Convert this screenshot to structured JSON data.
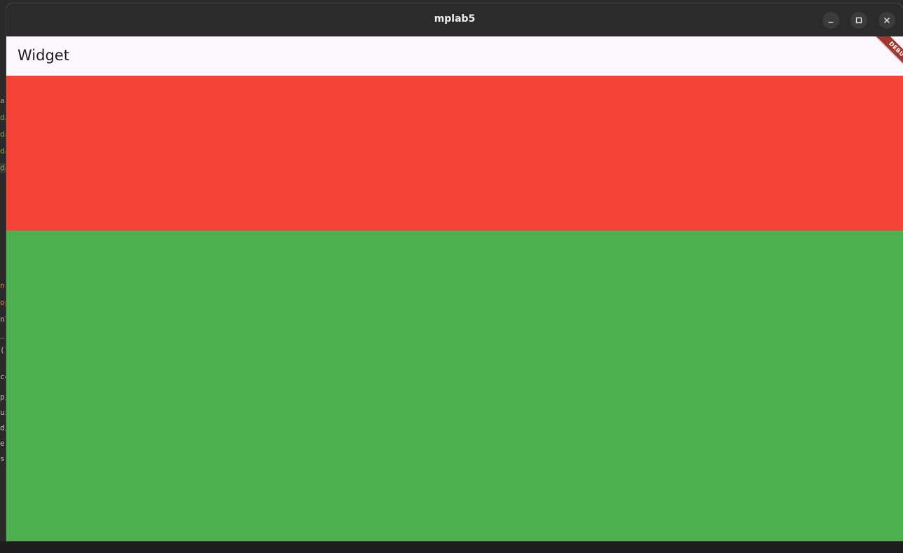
{
  "window": {
    "title": "mplab5",
    "controls": {
      "minimize_icon": "minimize-icon",
      "maximize_icon": "maximize-icon",
      "close_icon": "close-icon"
    }
  },
  "app": {
    "appbar_title": "Widget",
    "debug_banner": "DEBUG",
    "panels": [
      {
        "name": "red-container",
        "color": "#f44336"
      },
      {
        "name": "green-container",
        "color": "#4caf50"
      }
    ]
  },
  "background_editor": {
    "fragments": [
      {
        "text": "a",
        "color": "#9c9c9c"
      },
      {
        "text": "da",
        "color": "#7e9f5a"
      },
      {
        "text": "da",
        "color": "#7e9f5a"
      },
      {
        "text": "da",
        "color": "#7e9f5a"
      },
      {
        "text": "da",
        "color": "#7e9f5a"
      },
      {
        "text": "n",
        "color": "#d77c5a"
      },
      {
        "text": "op",
        "color": "#d77c5a"
      },
      {
        "text": "nl",
        "color": "#bdbdbd"
      },
      {
        "text": "_",
        "color": "#bdbdbd"
      },
      {
        "text": "(l",
        "color": "#bdbdbd"
      },
      {
        "text": "co",
        "color": "#bdbdbd"
      },
      {
        "text": "p/",
        "color": "#bdbdbd"
      },
      {
        "text": "ux",
        "color": "#bdbdbd"
      },
      {
        "text": "d/",
        "color": "#bdbdbd"
      },
      {
        "text": "e",
        "color": "#bdbdbd"
      },
      {
        "text": "s",
        "color": "#bdbdbd"
      }
    ]
  }
}
